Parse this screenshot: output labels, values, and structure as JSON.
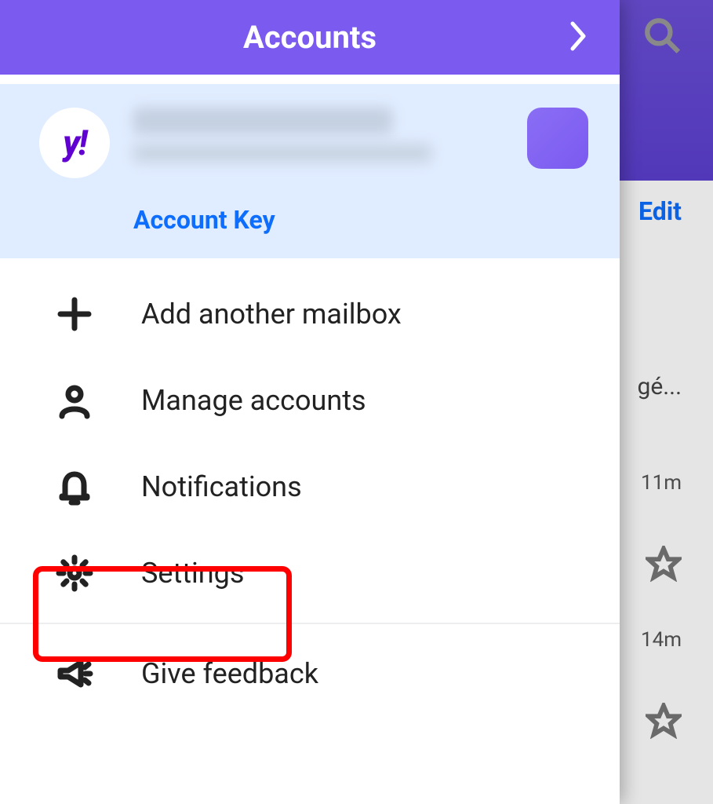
{
  "panel": {
    "title": "Accounts",
    "account": {
      "avatar_text": "y!",
      "account_key": "Account Key"
    },
    "menu": {
      "add_mailbox": "Add another mailbox",
      "manage_accounts": "Manage accounts",
      "notifications": "Notifications",
      "settings": "Settings",
      "give_feedback": "Give feedback"
    }
  },
  "background": {
    "edit": "Edit",
    "row_suffix": "gé...",
    "time_1": "11m",
    "time_2": "14m"
  }
}
